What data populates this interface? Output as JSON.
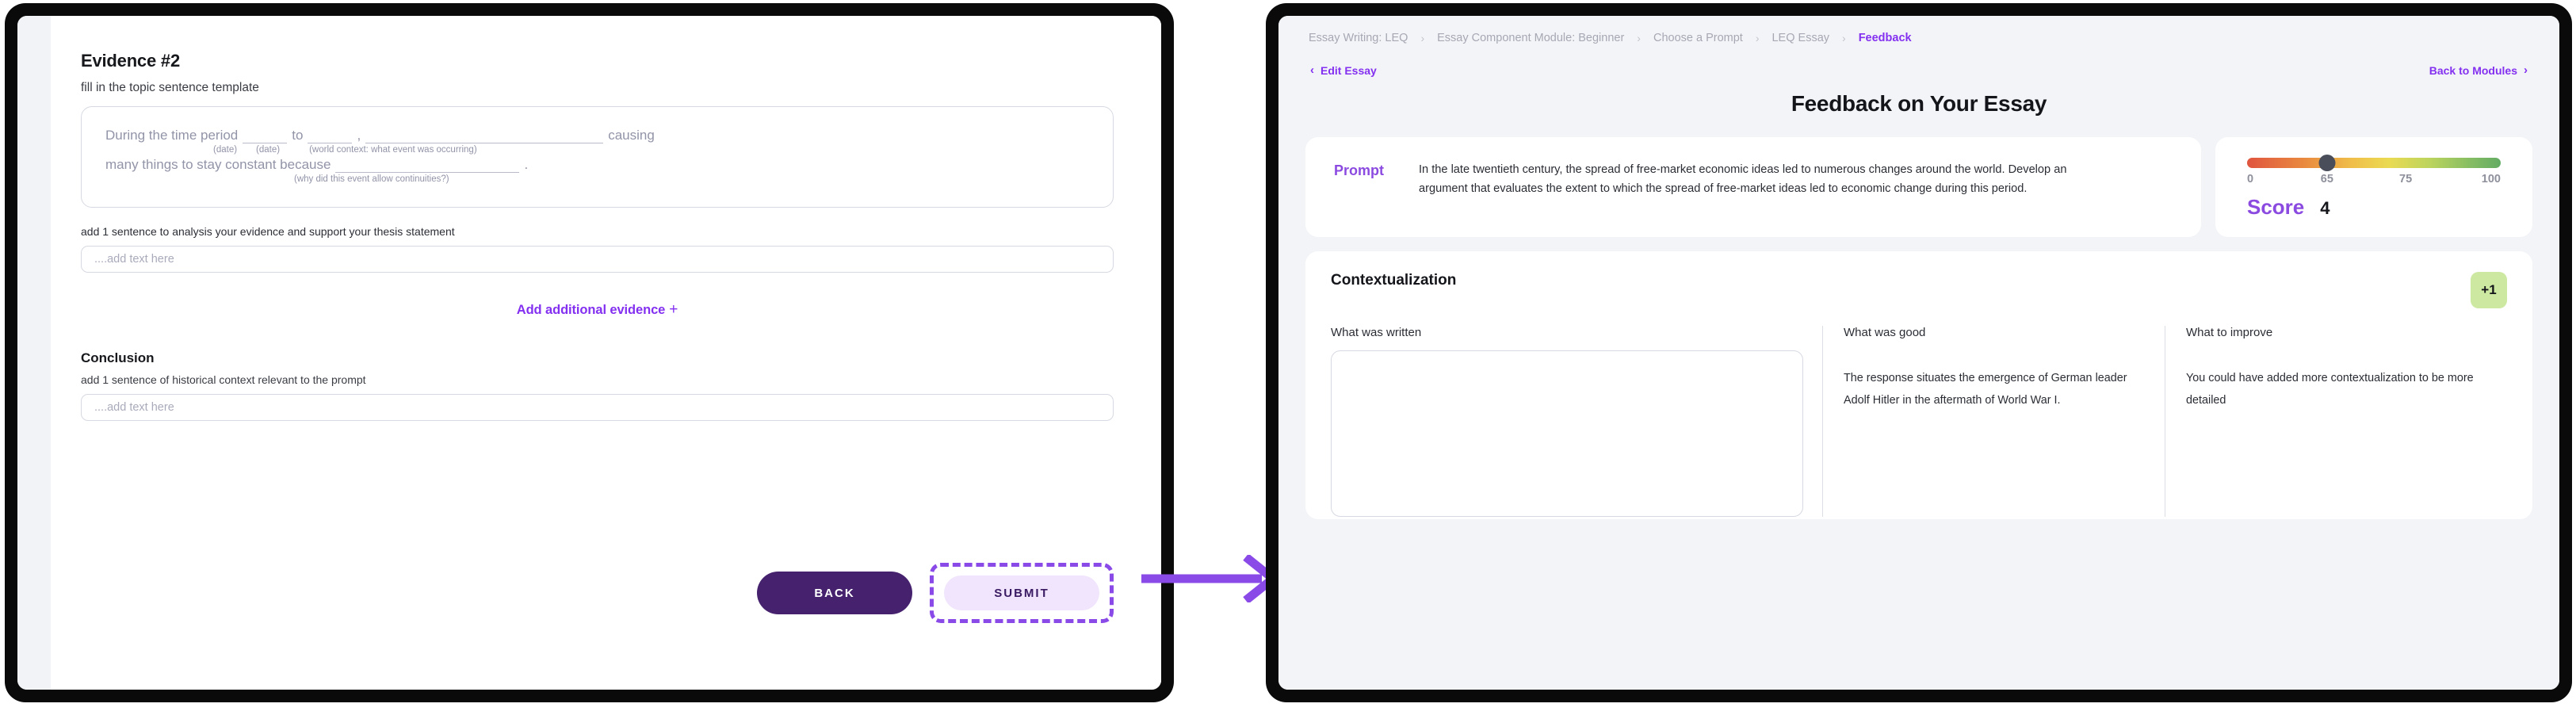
{
  "left_panel": {
    "evidence": {
      "title": "Evidence #2",
      "subtitle": "fill in the topic sentence template",
      "template": {
        "line1_prefix": "During the time period",
        "line1_mid": "to",
        "line1_comma": ",",
        "line1_suffix": "causing",
        "line2_prefix": "many things to stay constant because",
        "line2_period": ".",
        "hint_date_1": "(date)",
        "hint_date_2": "(date)",
        "hint_world_context": "(world context: what event was occurring)",
        "hint_why": "(why did this event allow continuities?)"
      },
      "analysis_label": "add 1 sentence to analysis your evidence and support your thesis statement",
      "analysis_placeholder": "....add text here"
    },
    "add_evidence_label": "Add additional evidence",
    "add_evidence_icon": "plus-icon",
    "conclusion": {
      "title": "Conclusion",
      "subtitle": "add 1 sentence of historical context relevant to the prompt",
      "placeholder": "....add text here"
    },
    "buttons": {
      "back": "BACK",
      "submit": "SUBMIT"
    }
  },
  "right_panel": {
    "breadcrumbs": [
      {
        "label": "Essay Writing: LEQ",
        "active": false
      },
      {
        "label": "Essay Component Module: Beginner",
        "active": false
      },
      {
        "label": "Choose a Prompt",
        "active": false
      },
      {
        "label": "LEQ Essay",
        "active": false
      },
      {
        "label": "Feedback",
        "active": true
      }
    ],
    "breadcrumb_separator": "›",
    "nav": {
      "edit_essay": "Edit Essay",
      "edit_essay_icon": "chevron-left-icon",
      "back_to_modules": "Back to Modules",
      "back_to_modules_icon": "chevron-right-icon"
    },
    "page_title": "Feedback on Your Essay",
    "prompt_card": {
      "label": "Prompt",
      "text": "In the late twentieth century, the spread of free-market economic ideas led to numerous changes around the world. Develop an argument that evaluates the extent to which the spread of free-market ideas led to economic change during this period."
    },
    "score_card": {
      "ticks": [
        "0",
        "65",
        "75",
        "100"
      ],
      "marker_value": 32,
      "score_label": "Score",
      "score_value": "4",
      "gradient_start": "#e0553f",
      "gradient_end": "#63ab63",
      "marker_color": "#4a4e5a"
    },
    "contextualization": {
      "title": "Contextualization",
      "badge": "+1",
      "badge_color": "#cde8a0",
      "written_label": "What was written",
      "written_text": "",
      "good_label": "What was good",
      "good_text": "The response situates the emergence of German leader Adolf Hitler in the aftermath of World War I.",
      "improve_label": "What to improve",
      "improve_text": "You could have added more contextualization to be more detailed"
    }
  },
  "annotation": {
    "arrow_color": "#8a4ae8",
    "highlight_color": "#8a4ae8"
  }
}
